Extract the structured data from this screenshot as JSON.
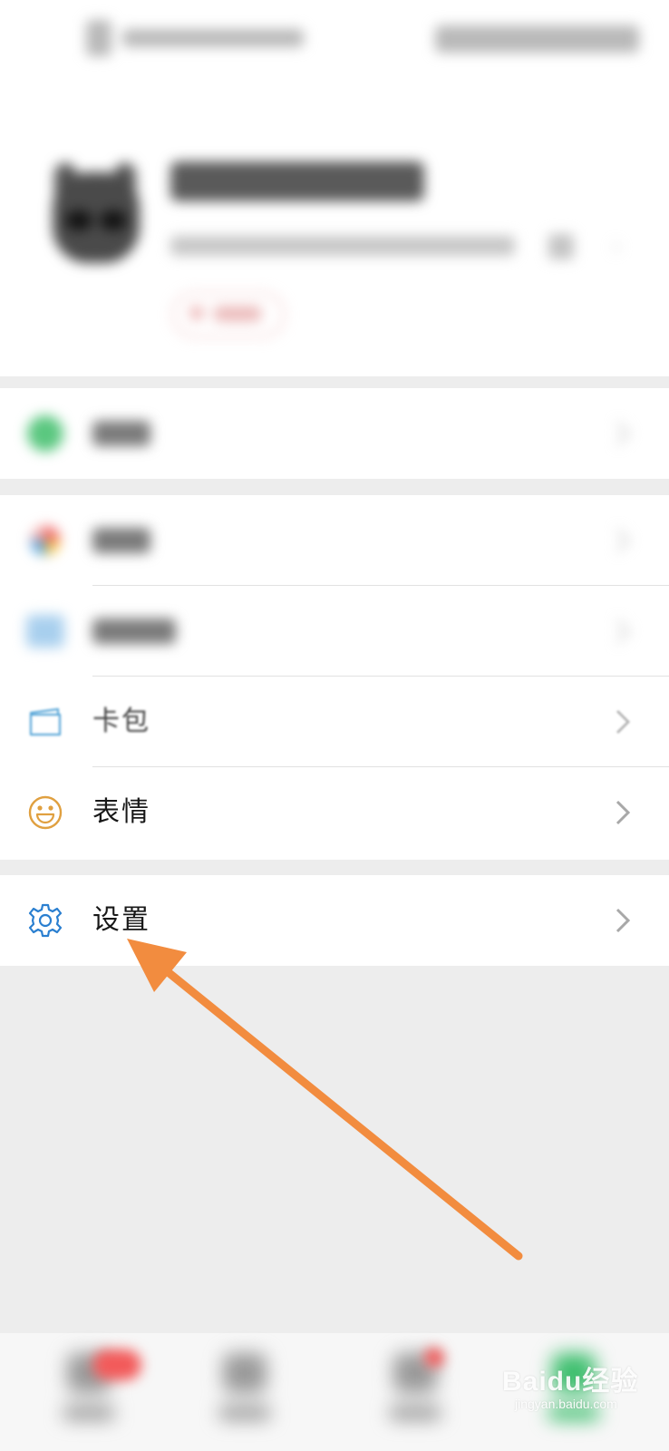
{
  "menu": {
    "group2": {
      "card_label": "卡包",
      "sticker_label": "表情"
    },
    "group3": {
      "settings_label": "设置"
    }
  },
  "watermark": {
    "main": "Baidu经验",
    "sub": "jingyan.baidu.com"
  },
  "colors": {
    "annotation_arrow": "#f28c3f",
    "settings_icon": "#2a7fd0",
    "sticker_icon": "#e0a040",
    "card_icon": "#5aa7d8",
    "page_background": "#ededed"
  },
  "icons": {
    "card": "card-wallet-icon",
    "sticker": "smiley-icon",
    "settings": "gear-icon",
    "chevron": "chevron-right-icon"
  }
}
